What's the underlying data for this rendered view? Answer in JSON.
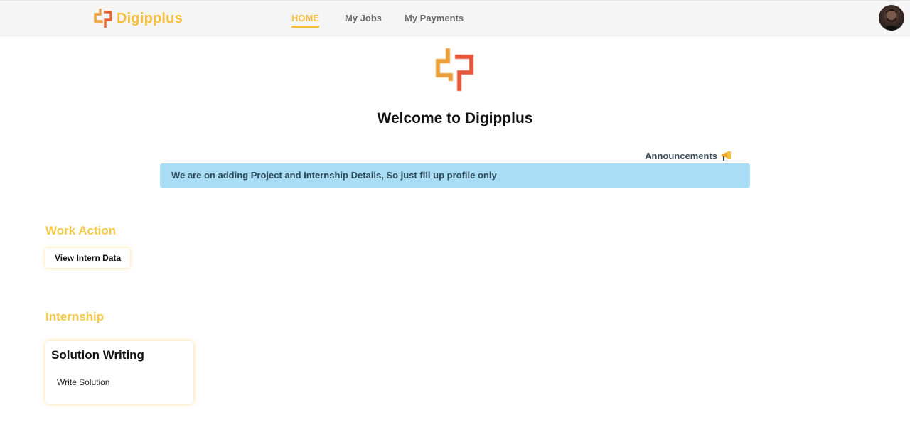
{
  "brand": {
    "name": "Digipplus",
    "color": "#f6bf3b",
    "logo_icon": "digipplus-logo-icon"
  },
  "nav": {
    "items": [
      {
        "label": "HOME",
        "active": true
      },
      {
        "label": "My Jobs",
        "active": false
      },
      {
        "label": "My Payments",
        "active": false
      }
    ],
    "avatar_icon": "user-avatar"
  },
  "main": {
    "welcome": "Welcome to Digipplus",
    "announcements": {
      "label": "Announcements",
      "icon": "megaphone-icon",
      "message": "We are on adding Project and Internship Details, So just fill up profile only",
      "bar_color": "#a9ddf6"
    },
    "work_action": {
      "title": "Work Action",
      "button_label": "View Intern Data"
    },
    "internship": {
      "title": "Internship",
      "cards": [
        {
          "title": "Solution Writing",
          "subtitle": "Write Solution"
        }
      ]
    }
  },
  "colors": {
    "accent": "#f6c94a",
    "logo_orange": "#e9863a",
    "logo_red": "#e5573a"
  }
}
